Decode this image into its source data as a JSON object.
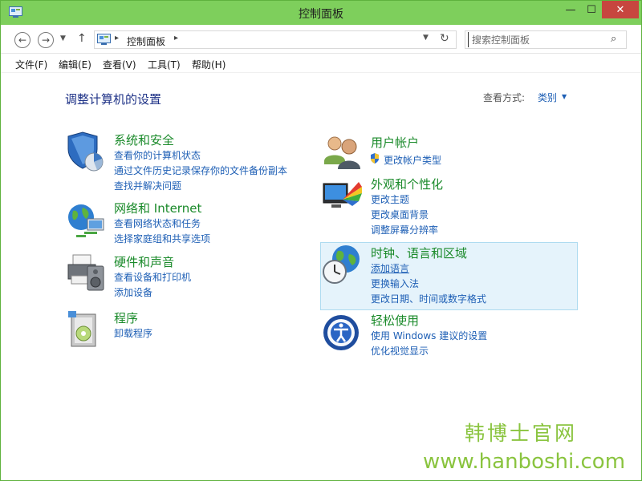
{
  "window": {
    "title": "控制面板",
    "controls": {
      "minimize": "—",
      "maximize": "☐",
      "close": "✕"
    }
  },
  "nav": {
    "back": "←",
    "forward": "→",
    "recent": "▼",
    "up": "↑",
    "address_sep": "▸",
    "address_text": "控制面板",
    "address_drop": "▼",
    "refresh": "↻",
    "search_placeholder": "搜索控制面板",
    "search_icon": "⌕"
  },
  "menu": [
    "文件(F)",
    "编辑(E)",
    "查看(V)",
    "工具(T)",
    "帮助(H)"
  ],
  "main": {
    "heading": "调整计算机的设置",
    "view_by_label": "查看方式:",
    "view_by_value": "类别",
    "view_by_arrow": "▼"
  },
  "categories_left": [
    {
      "title": "系统和安全",
      "icon": "shield-icon",
      "links": [
        "查看你的计算机状态",
        "通过文件历史记录保存你的文件备份副本",
        "查找并解决问题"
      ]
    },
    {
      "title": "网络和 Internet",
      "icon": "network-globe-icon",
      "links": [
        "查看网络状态和任务",
        "选择家庭组和共享选项"
      ]
    },
    {
      "title": "硬件和声音",
      "icon": "printer-speaker-icon",
      "links": [
        "查看设备和打印机",
        "添加设备"
      ]
    },
    {
      "title": "程序",
      "icon": "programs-box-icon",
      "links": [
        "卸载程序"
      ]
    }
  ],
  "categories_right": [
    {
      "title": "用户帐户",
      "icon": "users-icon",
      "links": [
        "更改帐户类型"
      ]
    },
    {
      "title": "外观和个性化",
      "icon": "monitor-palette-icon",
      "links": [
        "更改主题",
        "更改桌面背景",
        "调整屏幕分辨率"
      ]
    },
    {
      "title": "时钟、语言和区域",
      "icon": "clock-globe-icon",
      "links": [
        "添加语言",
        "更换输入法",
        "更改日期、时间或数字格式"
      ]
    },
    {
      "title": "轻松使用",
      "icon": "ease-of-access-icon",
      "links": [
        "使用 Windows 建议的设置",
        "优化视觉显示"
      ]
    }
  ],
  "watermark": {
    "line1": "韩博士官网",
    "line2": "www.hanboshi.com"
  },
  "colors": {
    "titlebar": "#7ecf5c",
    "link": "#1e5fb5",
    "category_title": "#1a8a2a",
    "heading": "#1e3287",
    "watermark": "#8ac43f",
    "close": "#c7463f"
  }
}
